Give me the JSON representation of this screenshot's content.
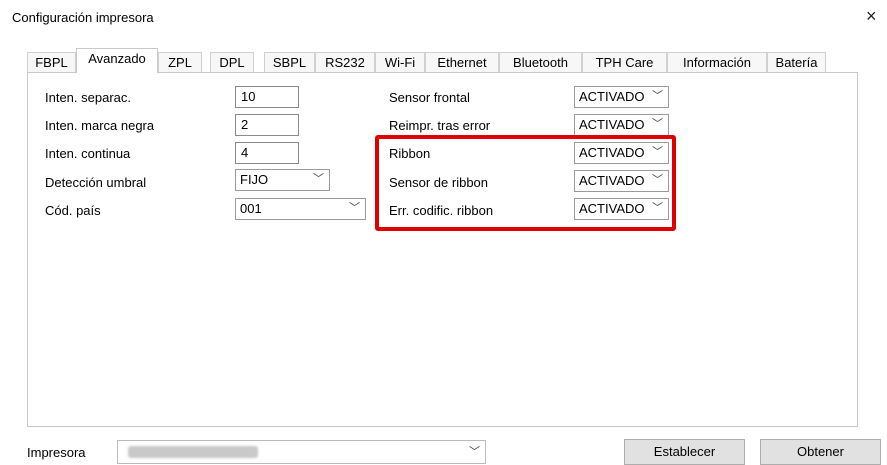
{
  "window": {
    "title": "Configuración impresora",
    "close_glyph": "×"
  },
  "tabs": [
    {
      "label": "FBPL"
    },
    {
      "label": "Avanzado",
      "active": true
    },
    {
      "label": "ZPL"
    },
    {
      "label": "DPL"
    },
    {
      "label": "SBPL"
    },
    {
      "label": "RS232"
    },
    {
      "label": "Wi-Fi"
    },
    {
      "label": "Ethernet"
    },
    {
      "label": "Bluetooth"
    },
    {
      "label": "TPH Care"
    },
    {
      "label": "Información"
    },
    {
      "label": "Batería"
    }
  ],
  "left_fields": {
    "separac": {
      "label": "Inten. separac.",
      "value": "10"
    },
    "marca_negra": {
      "label": "Inten. marca negra",
      "value": "2"
    },
    "continua": {
      "label": "Inten. continua",
      "value": "4"
    },
    "deteccion": {
      "label": "Detección umbral",
      "value": "FIJO"
    },
    "pais": {
      "label": "Cód. país",
      "value": "001"
    }
  },
  "right_fields": {
    "sensor_frontal": {
      "label": "Sensor frontal",
      "value": "ACTIVADO"
    },
    "reimpr": {
      "label": "Reimpr. tras error",
      "value": "ACTIVADO"
    },
    "ribbon": {
      "label": "Ribbon",
      "value": "ACTIVADO"
    },
    "sensor_ribbon": {
      "label": "Sensor de ribbon",
      "value": "ACTIVADO"
    },
    "err_ribbon": {
      "label": "Err. codific. ribbon",
      "value": "ACTIVADO"
    }
  },
  "bottom": {
    "printer_label": "Impresora",
    "set_button": "Establecer",
    "get_button": "Obtener"
  },
  "chevron_glyph": "﹀",
  "highlight_color": "#e00000"
}
